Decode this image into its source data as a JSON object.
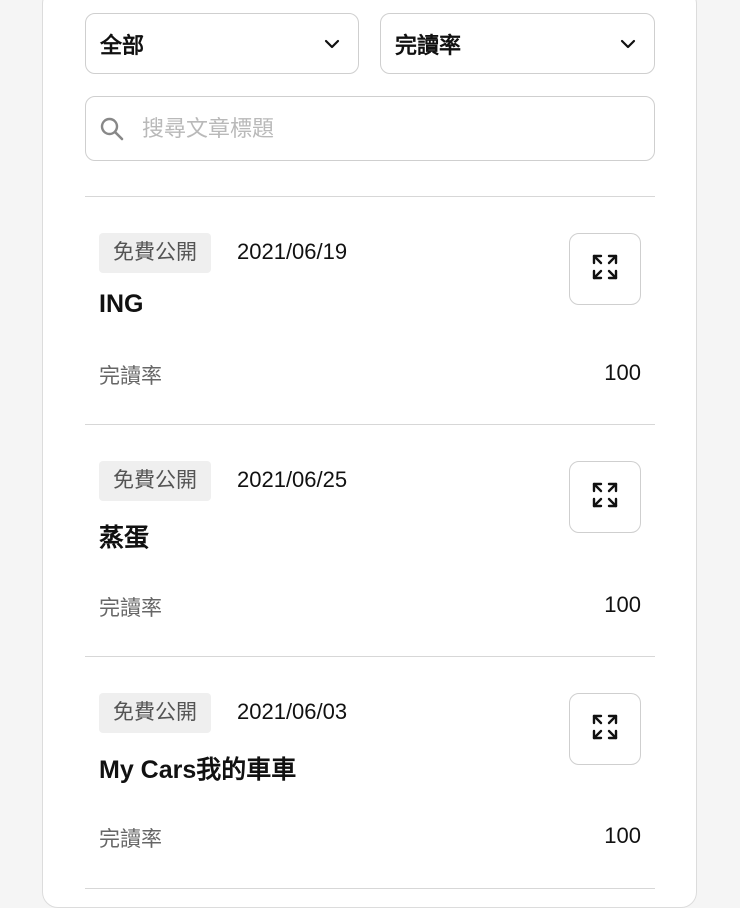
{
  "filters": {
    "category": {
      "selected": "全部"
    },
    "sort": {
      "selected": "完讀率"
    }
  },
  "search": {
    "placeholder": "搜尋文章標題",
    "value": ""
  },
  "icons": {
    "search": "search-icon",
    "dropdown": "chevron-down-icon",
    "expand": "expand-icon"
  },
  "articles": [
    {
      "badge": "免費公開",
      "date": "2021/06/19",
      "title": "ING",
      "metric_label": "完讀率",
      "metric_value": "100"
    },
    {
      "badge": "免費公開",
      "date": "2021/06/25",
      "title": "蒸蛋",
      "metric_label": "完讀率",
      "metric_value": "100"
    },
    {
      "badge": "免費公開",
      "date": "2021/06/03",
      "title": "My Cars我的車車",
      "metric_label": "完讀率",
      "metric_value": "100"
    }
  ]
}
